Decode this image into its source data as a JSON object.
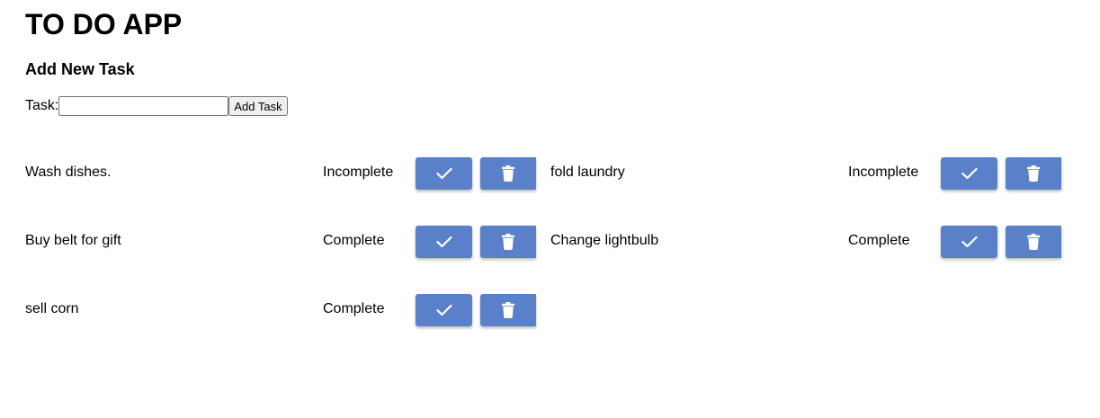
{
  "app": {
    "title": "TO DO APP"
  },
  "form": {
    "section_title": "Add New Task",
    "task_label": "Task:",
    "task_input_value": "",
    "task_input_placeholder": "",
    "add_button_label": "Add Task"
  },
  "tasks": [
    {
      "name": "Wash dishes.",
      "status": "Incomplete"
    },
    {
      "name": "fold laundry",
      "status": "Incomplete"
    },
    {
      "name": "Buy belt for gift",
      "status": "Complete"
    },
    {
      "name": "Change lightbulb",
      "status": "Complete"
    },
    {
      "name": "sell corn",
      "status": "Complete"
    }
  ],
  "icons": {
    "complete": "check-icon",
    "delete": "trash-icon"
  },
  "colors": {
    "button_bg": "#5a80c9",
    "icon": "#ffffff"
  }
}
